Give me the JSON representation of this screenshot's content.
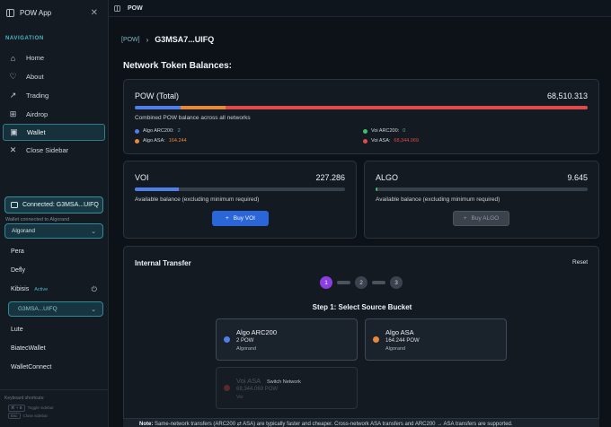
{
  "app": {
    "title": "POW App"
  },
  "topbar": {
    "title": "POW"
  },
  "sidebar": {
    "nav_label": "NAVIGATION",
    "items": [
      {
        "label": "Home",
        "icon": "home-icon",
        "glyph": "⌂"
      },
      {
        "label": "About",
        "icon": "heart-icon",
        "glyph": "♡"
      },
      {
        "label": "Trading",
        "icon": "trend-icon",
        "glyph": "↗"
      },
      {
        "label": "Airdrop",
        "icon": "gift-icon",
        "glyph": "⊞"
      },
      {
        "label": "Wallet",
        "icon": "wallet-icon",
        "glyph": "▣"
      },
      {
        "label": "Close Sidebar",
        "icon": "close-icon",
        "glyph": "✕"
      }
    ],
    "connected_label": "Connected: G3MSA...UIFQ",
    "connected_sub": "Wallet connected to Algorand",
    "network_select": "Algorand",
    "wallets": [
      "Pera",
      "Defly",
      "Kibisis",
      "Lute",
      "BiatecWallet",
      "WalletConnect"
    ],
    "active_badge": "Active",
    "address_select": "G3MSA...UIFQ",
    "shortcuts_title": "Keyboard shortcuts:",
    "shortcut_1_keys": "⌘ + B",
    "shortcut_1_label": "Toggle sidebar",
    "shortcut_2_keys": "Esc",
    "shortcut_2_label": "Close sidebar"
  },
  "main": {
    "crumb_tag": "[POW]",
    "crumb_addr": "G3MSA7...UIFQ",
    "section_title": "Network Token Balances:",
    "total": {
      "label": "POW (Total)",
      "amount": "68,510.313",
      "sub": "Combined POW balance across all networks",
      "legend": [
        {
          "label": "Algo ARC200:",
          "value": "2",
          "color": "#4f7fe8"
        },
        {
          "label": "Algo ASA:",
          "value": "164.244",
          "color": "#e8883a"
        },
        {
          "label": "Voi ARC200:",
          "value": "0",
          "color": "#3ec06a"
        },
        {
          "label": "Voi ASA:",
          "value": "68,344.069",
          "color": "#e04a4a"
        }
      ],
      "segments": [
        {
          "color": "#4f7fe8",
          "fraction": 0.101
        },
        {
          "color": "#e8883a",
          "fraction": 0.099
        },
        {
          "color": "#e04a4a",
          "fraction": 0.8
        }
      ]
    },
    "voi": {
      "label": "VOI",
      "amount": "227.286",
      "sub": "Available balance (excluding minimum required)",
      "fill": 0.21,
      "button": "Buy VOI",
      "bar_color": "#4f7fe8"
    },
    "algo": {
      "label": "ALGO",
      "amount": "9.645",
      "sub": "Available balance (excluding minimum required)",
      "fill": 0.01,
      "button": "Buy ALGO",
      "bar_color": "#3ec06a"
    },
    "transfer": {
      "title": "Internal Transfer",
      "reset": "Reset",
      "steps": [
        "1",
        "2",
        "3"
      ],
      "step_title": "Step 1: Select Source Bucket",
      "buckets": [
        {
          "name": "Algo ARC200",
          "amount": "2 POW",
          "network": "Algorand",
          "color": "#4f7fe8"
        },
        {
          "name": "Algo ASA",
          "amount": "164.244 POW",
          "network": "Algorand",
          "color": "#e8883a"
        },
        {
          "name": "Voi ASA",
          "amount": "68,344.069 POW",
          "network": "Voi",
          "color": "#5a2a2a",
          "hint": "Switch Network"
        }
      ]
    },
    "note_label": "Note:",
    "note_text": "Same-network transfers (ARC200 ⇄ ASA) are typically faster and cheaper. Cross-network ASA transfers and ARC200 → ASA transfers are supported."
  }
}
